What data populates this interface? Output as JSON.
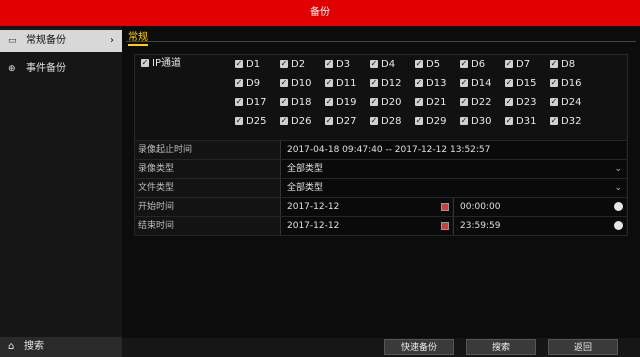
{
  "window": {
    "title": "备份"
  },
  "sidebar": {
    "items": [
      {
        "label": "常规备份",
        "icon": "disk-icon",
        "active": true
      },
      {
        "label": "事件备份",
        "icon": "pin-icon",
        "active": false
      }
    ],
    "search_label": "搜索"
  },
  "main": {
    "tab": "常规",
    "ip_channel_label": "IP通道",
    "channels": [
      "D1",
      "D2",
      "D3",
      "D4",
      "D5",
      "D6",
      "D7",
      "D8",
      "D9",
      "D10",
      "D11",
      "D12",
      "D13",
      "D14",
      "D15",
      "D16",
      "D17",
      "D18",
      "D19",
      "D20",
      "D21",
      "D22",
      "D23",
      "D24",
      "D25",
      "D26",
      "D27",
      "D28",
      "D29",
      "D30",
      "D31",
      "D32"
    ],
    "fields": {
      "record_range": {
        "label": "录像起止时间",
        "value": "2017-04-18 09:47:40 -- 2017-12-12 13:52:57"
      },
      "record_type": {
        "label": "录像类型",
        "value": "全部类型"
      },
      "file_type": {
        "label": "文件类型",
        "value": "全部类型"
      },
      "start_time": {
        "label": "开始时间",
        "date": "2017-12-12",
        "time": "00:00:00"
      },
      "end_time": {
        "label": "结束时间",
        "date": "2017-12-12",
        "time": "23:59:59"
      }
    }
  },
  "buttons": {
    "quick_backup": "快速备份",
    "search": "搜索",
    "back": "返回"
  },
  "colors": {
    "accent": "#e00000",
    "tab": "#ffd000"
  }
}
